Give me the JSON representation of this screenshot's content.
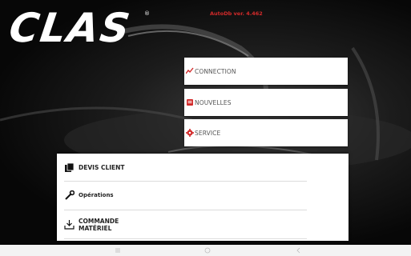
{
  "brand": {
    "logo_text": "CLAS",
    "registered_mark": "®"
  },
  "version_text": "AutoDb ver. 4.462",
  "menu": [
    {
      "label": "CONNECTION",
      "icon": "trend-line-icon"
    },
    {
      "label": "NOUVELLES",
      "icon": "news-icon"
    },
    {
      "label": "SERVICE",
      "icon": "gear-icon"
    }
  ],
  "panel_items": [
    {
      "label": "DEVIS CLIENT",
      "icon": "copy-documents-icon"
    },
    {
      "label": "Opérations",
      "icon": "wrench-icon"
    },
    {
      "label_line1": "COMMANDE",
      "label_line2": "MATÉRIEL",
      "icon": "download-tray-icon"
    }
  ],
  "nav": {
    "recent": "|||",
    "home": "○",
    "back": "‹"
  },
  "colors": {
    "accent_red": "#d22a2a",
    "background": "#000000",
    "card": "#ffffff"
  }
}
